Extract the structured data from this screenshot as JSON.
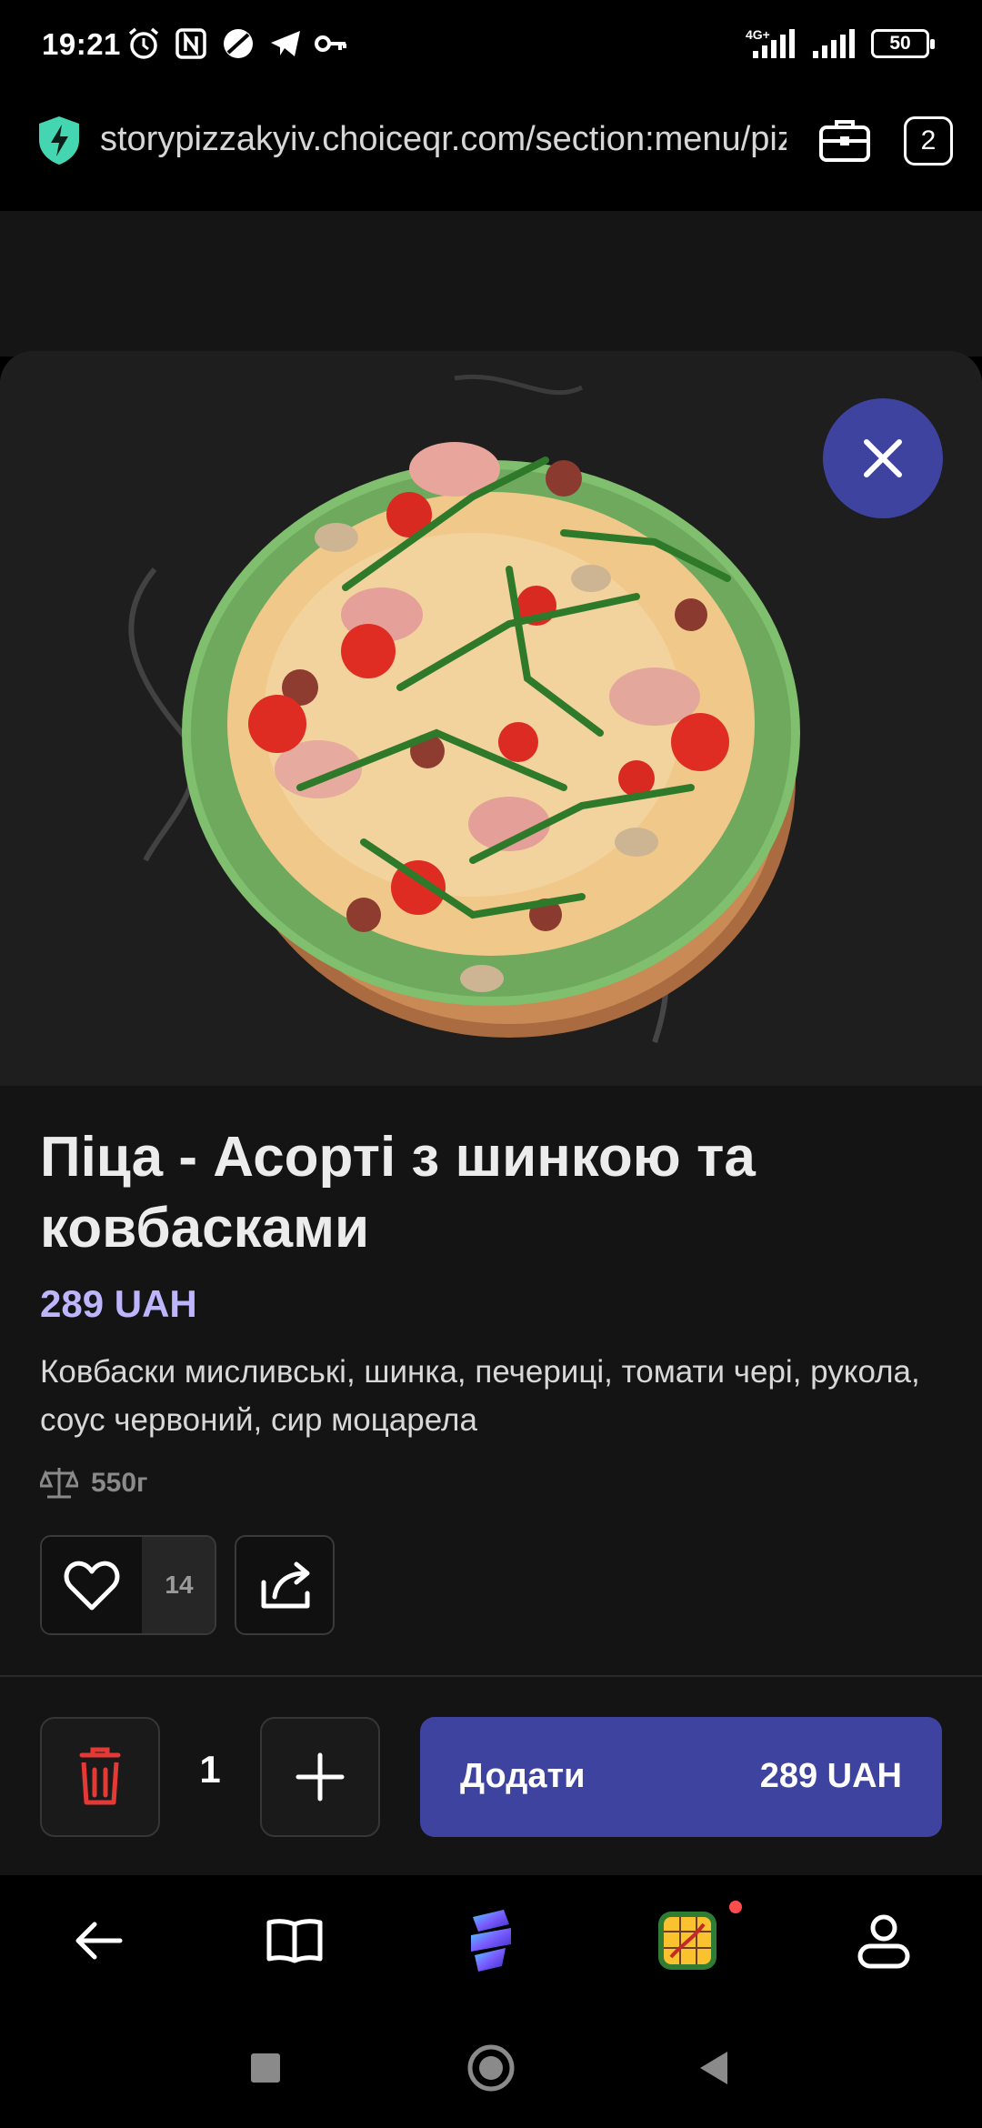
{
  "status_bar": {
    "time": "19:21",
    "network": "4G+",
    "battery": "50",
    "icons": [
      "alarm-icon",
      "nfc-icon",
      "app-icon",
      "telegram-icon",
      "key-icon"
    ]
  },
  "browser": {
    "url": "storypizzakyiv.choiceqr.com/section:menu/pizza",
    "tabs_count": "2"
  },
  "product": {
    "title": "Піца - Асорті з шинкою та ковбасками",
    "price": "289 UAH",
    "description": "Ковбаски мисливські, шинка, печериці, томати чері, рукола, соус червоний, сир моцарела",
    "weight": "550г",
    "likes": "14",
    "image": "pizza-photo"
  },
  "cart": {
    "quantity": "1",
    "add_label": "Додати",
    "add_price": "289 UAH"
  },
  "colors": {
    "accent": "#3f43a0",
    "price": "#bdb6ff",
    "delete": "#e53935",
    "background": "#141414"
  },
  "browser_nav": {
    "items": [
      "back-icon",
      "bookmarks-icon",
      "app-logo-icon",
      "game-icon",
      "profile-icon"
    ]
  }
}
